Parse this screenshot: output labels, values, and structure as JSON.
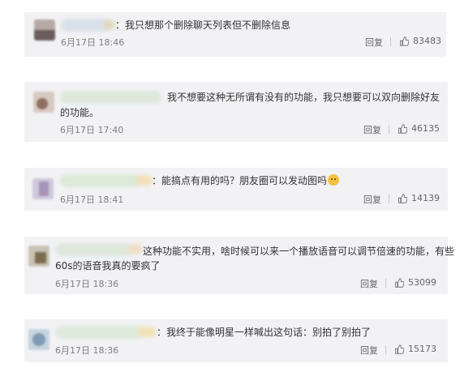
{
  "comments": [
    {
      "text_line1": "：我只想那个删除聊天列表但不删除信息",
      "text_line2": "",
      "time": "6月17日 18:46",
      "reply_label": "回复",
      "likes": "83483"
    },
    {
      "text_line1": "我不想要这种无所谓有没有的功能，我只想要可以双向删除好友",
      "text_line2": "的功能。",
      "time": "6月17日 17:40",
      "reply_label": "回复",
      "likes": "46135"
    },
    {
      "text_line1": "：能搞点有用的吗？朋友圈可以发动图吗",
      "text_line2": "",
      "time": "6月17日 18:41",
      "reply_label": "回复",
      "likes": "14139",
      "emoji": "grimace-emoji"
    },
    {
      "text_line1": "这种功能不实用，啥时候可以来一个播放语音可以调节倍速的功能，有些",
      "text_line2": "60s的语音我真的要疯了",
      "time": "6月17日 18:36",
      "reply_label": "回复",
      "likes": "53099"
    },
    {
      "text_line1": "：我终于能像明星一样喊出这句话：别拍了别拍了",
      "text_line2": "",
      "time": "6月17日 18:36",
      "reply_label": "回复",
      "likes": "15173"
    }
  ],
  "icons": {
    "like": "thumbs-up-icon"
  },
  "colors": {
    "card_bg": "#f2f2f5",
    "text": "#333333",
    "meta": "#808080"
  }
}
